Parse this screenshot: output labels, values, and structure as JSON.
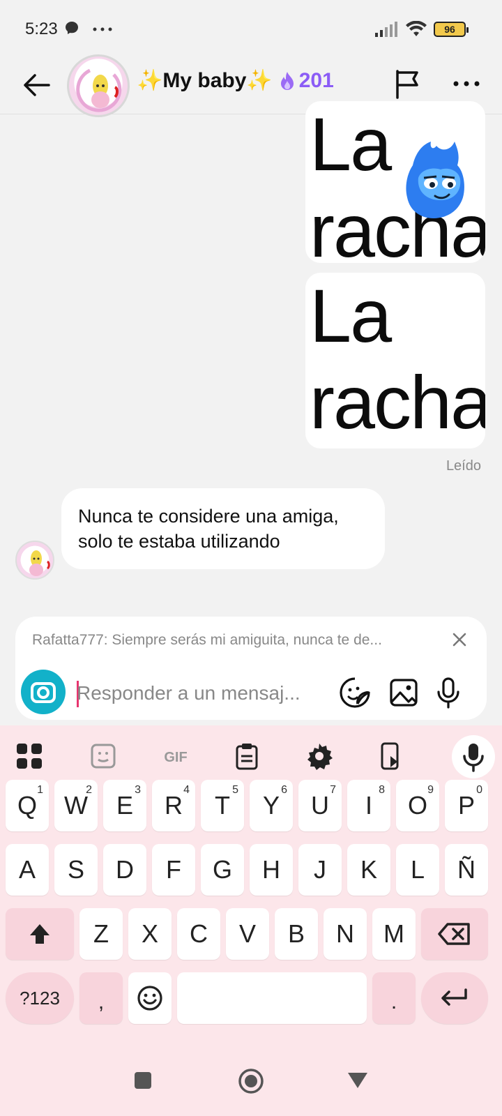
{
  "status_bar": {
    "time": "5:23",
    "left_icons": "messenger-icon, more-dots",
    "battery": "96"
  },
  "header": {
    "title": "✨My baby✨",
    "streak_count": "201",
    "streak_icon": "flame-icon",
    "accent_color": "#8b5cf6"
  },
  "messages": {
    "sticker_1_text": "La\nracha",
    "sticker_2_text": "La\nracha",
    "read_status": "Leído",
    "incoming_text": "Nunca te considere una amiga, solo te estaba utilizando"
  },
  "composer": {
    "reply_quote": "Rafatta777: Siempre serás mi amiguita, nunca te de...",
    "placeholder": "Responder a un mensaj...",
    "camera_color": "#12b1c9"
  },
  "keyboard": {
    "row1": [
      {
        "k": "Q",
        "s": "1"
      },
      {
        "k": "W",
        "s": "2"
      },
      {
        "k": "E",
        "s": "3"
      },
      {
        "k": "R",
        "s": "4"
      },
      {
        "k": "T",
        "s": "5"
      },
      {
        "k": "Y",
        "s": "6"
      },
      {
        "k": "U",
        "s": "7"
      },
      {
        "k": "I",
        "s": "8"
      },
      {
        "k": "O",
        "s": "9"
      },
      {
        "k": "P",
        "s": "0"
      }
    ],
    "row2": [
      "A",
      "S",
      "D",
      "F",
      "G",
      "H",
      "J",
      "K",
      "L",
      "Ñ"
    ],
    "row3": [
      "Z",
      "X",
      "C",
      "V",
      "B",
      "N",
      "M"
    ],
    "symbols_key": "?123",
    "comma_key": ",",
    "period_key": ".",
    "background": "#fce6ea"
  }
}
